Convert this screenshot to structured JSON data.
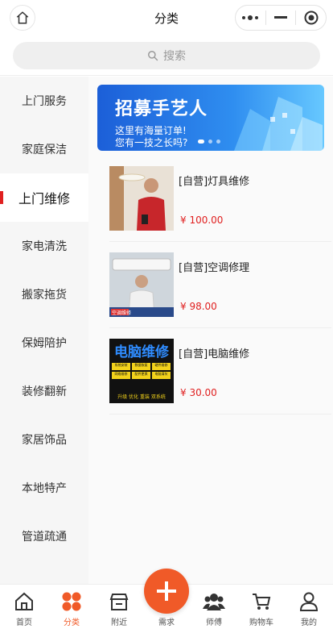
{
  "header": {
    "title": "分类",
    "home_icon": "home-icon",
    "more_icon": "more-dots-icon",
    "minimize_icon": "minimize-icon",
    "close_icon": "target-circle-icon"
  },
  "search": {
    "placeholder": "搜索",
    "icon": "search-icon"
  },
  "sidebar": {
    "items": [
      {
        "label": "上门服务"
      },
      {
        "label": "家庭保洁"
      },
      {
        "label": "上门维修",
        "active": true
      },
      {
        "label": "家电清洗"
      },
      {
        "label": "搬家拖货"
      },
      {
        "label": "保姆陪护"
      },
      {
        "label": "装修翻新"
      },
      {
        "label": "家居饰品"
      },
      {
        "label": "本地特产"
      },
      {
        "label": "管道疏通"
      }
    ],
    "active_color": "#e02020"
  },
  "banner": {
    "title": "招募手艺人",
    "subtitle_line1": "这里有海量订单!",
    "subtitle_line2": "您有一技之长吗?"
  },
  "products": [
    {
      "name": "[自营]灯具维修",
      "price": "¥ 100.00"
    },
    {
      "name": "[自营]空调修理",
      "price": "¥ 98.00"
    },
    {
      "name": "[自营]电脑维修",
      "price": "¥ 30.00"
    }
  ],
  "thumb_text": {
    "repair_title": "电脑维修",
    "chips": [
      "系统安装",
      "数据恢复",
      "硬件维修",
      "网络维修",
      "配件更换",
      "电脑清灰"
    ],
    "footer": "升级 优化 重装 双系统",
    "ac_text": "空调维修"
  },
  "tabbar": {
    "items": [
      {
        "label": "首页",
        "icon": "home-icon"
      },
      {
        "label": "分类",
        "icon": "category-dots-icon",
        "active": true
      },
      {
        "label": "附近",
        "icon": "shop-icon"
      },
      {
        "label": "需求",
        "icon": "plus-icon"
      },
      {
        "label": "师傅",
        "icon": "people-icon"
      },
      {
        "label": "购物车",
        "icon": "cart-icon"
      },
      {
        "label": "我的",
        "icon": "user-icon"
      }
    ],
    "accent": "#f05a28"
  }
}
